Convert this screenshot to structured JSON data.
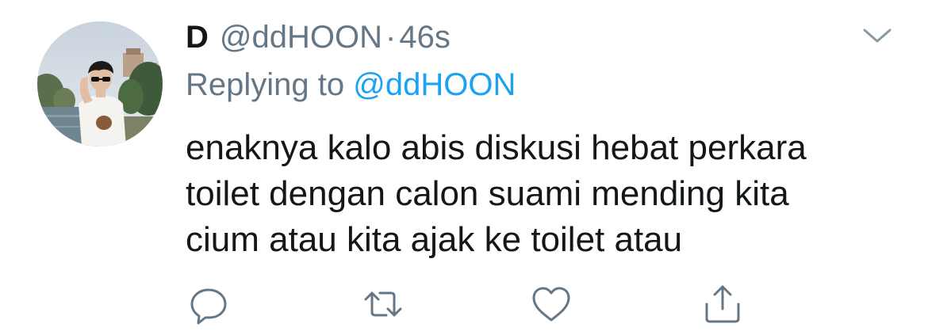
{
  "tweet": {
    "author": {
      "display_name": "D",
      "handle": "@ddHOON",
      "avatar_icon": "profile-photo"
    },
    "separator": "·",
    "timestamp": "46s",
    "reply": {
      "prefix": "Replying to",
      "mention": "@ddHOON"
    },
    "text_lines": [
      "enaknya kalo abis diskusi hebat perkara",
      "toilet dengan calon suami mending kita",
      "cium atau kita ajak ke toilet atau"
    ],
    "menu_icon": "chevron-down-icon",
    "actions": [
      {
        "name": "reply",
        "icon": "speech-bubble-icon"
      },
      {
        "name": "retweet",
        "icon": "retweet-arrows-icon"
      },
      {
        "name": "like",
        "icon": "heart-icon"
      },
      {
        "name": "share",
        "icon": "share-upload-icon"
      }
    ]
  },
  "colors": {
    "text": "#14171a",
    "secondary": "#657786",
    "link": "#1da1f2",
    "background": "#ffffff"
  }
}
